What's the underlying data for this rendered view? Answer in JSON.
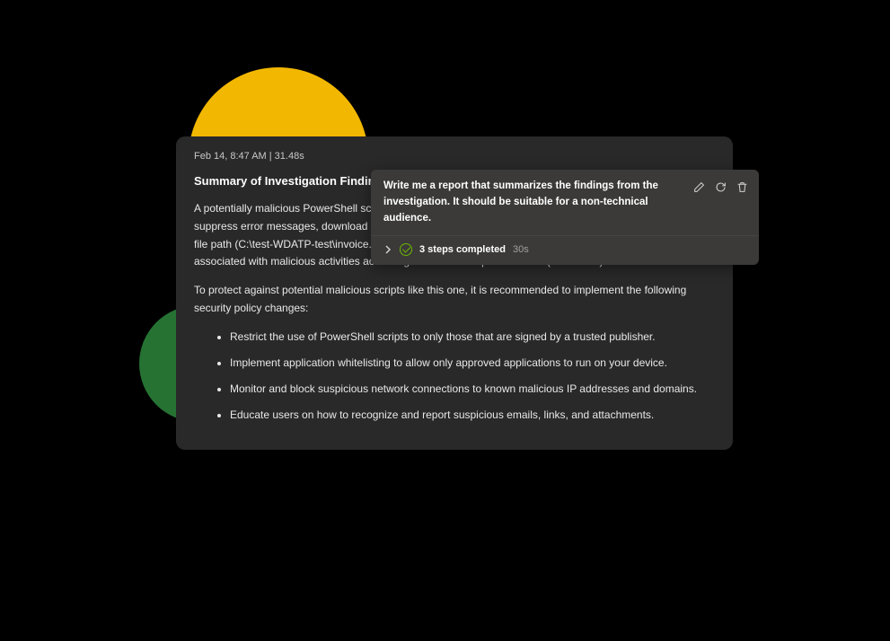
{
  "decorations": {
    "yellow_circle": "#F2B700",
    "green_circle": "#257233",
    "blue_rect": "#0078D4"
  },
  "report": {
    "timestamp": "Feb 14, 8:47 AM  |  31.48s",
    "title": "Summary of Investigation Findings",
    "para1": "A potentially malicious PowerShell script was discovered on your device. This script was designed to suppress error messages, download an executable file from a remote IP address (185.82.217.3) to a local file path (C:\\test-WDATP-test\\invoice.exe), and then execute this file. The IP address 185.82.217.3 is associated with malicious activities according to the MDTI reputation data (HAFNIUM).",
    "para2": "To protect against potential malicious scripts like this one, it is recommended to implement the following security policy changes:",
    "bullets": [
      "Restrict the use of PowerShell scripts to only those that are signed by a trusted publisher.",
      "Implement application whitelisting to allow only approved applications to run on your device.",
      "Monitor and block suspicious network connections to known malicious IP addresses and domains.",
      "Educate users on how to recognize and report suspicious emails, links, and attachments."
    ]
  },
  "prompt": {
    "text": "Write me a report that summarizes the findings from the investigation. It should be suitable for a non-technical audience.",
    "status_label": "3 steps completed",
    "status_time": "30s",
    "icons": {
      "edit": "edit-icon",
      "refresh": "refresh-icon",
      "delete": "delete-icon",
      "expand": "chevron-right-icon",
      "check": "check-circle-icon"
    }
  }
}
